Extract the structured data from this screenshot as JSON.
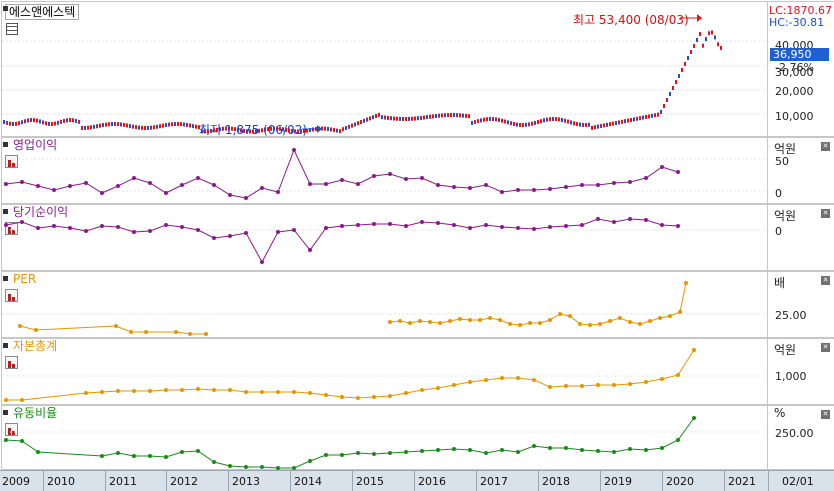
{
  "stock_name": "에스앤에스텍",
  "lc_label": "LC:1870.67",
  "hc_label": "HC:-30.81",
  "current_price": "36,950",
  "change_pct": "-2.76%",
  "high_annot": "최고 53,400 (08/03)",
  "low_annot": "최저 1,875 (06/02)",
  "price_ticks": [
    "40,000",
    "30,000",
    "20,000",
    "10,000"
  ],
  "indicators": [
    {
      "label": "영업이익",
      "color": "#8b1a8b",
      "unit": "억원",
      "ticks": [
        "50",
        "0"
      ]
    },
    {
      "label": "당기순이익",
      "color": "#8b1a8b",
      "unit": "억원",
      "ticks": [
        "0"
      ]
    },
    {
      "label": "PER",
      "color": "#e69500",
      "unit": "배",
      "ticks": [
        "25.00"
      ]
    },
    {
      "label": "자본총계",
      "color": "#e69500",
      "unit": "억원",
      "ticks": [
        "1,000"
      ]
    },
    {
      "label": "유동비율",
      "color": "#1a8a1a",
      "unit": "%",
      "ticks": [
        "250.00"
      ]
    }
  ],
  "x_labels": [
    "2009",
    "2010",
    "2011",
    "2012",
    "2013",
    "2014",
    "2015",
    "2016",
    "2017",
    "2018",
    "2019",
    "2020",
    "2021",
    "02/01"
  ],
  "colors": {
    "up": "#e0141e",
    "down": "#1a4fd6",
    "purple": "#8b1a8b",
    "orange": "#e69500",
    "green": "#1a8a1a",
    "pricebox": "#1f5fd0"
  }
}
